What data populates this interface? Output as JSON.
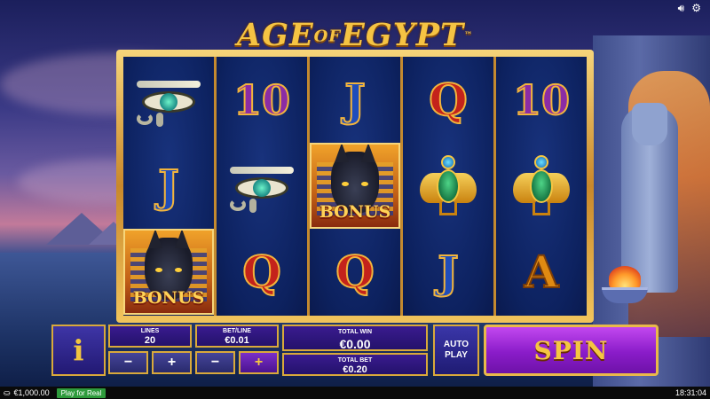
{
  "game": {
    "title_left": "AGE",
    "title_mid": "OF",
    "title_right": "EGYPT",
    "trademark": "™"
  },
  "top_icons": {
    "sound": "speaker-icon",
    "settings": "gear-icon"
  },
  "reels": [
    [
      "eye-of-horus",
      "J",
      "BONUS"
    ],
    [
      "10",
      "eye-of-horus",
      "Q"
    ],
    [
      "J",
      "BONUS",
      "Q"
    ],
    [
      "Q",
      "scarab",
      "J"
    ],
    [
      "10",
      "scarab",
      "A"
    ]
  ],
  "symbol_labels": {
    "ten": "10",
    "queen": "Q",
    "jack": "J",
    "ace": "A",
    "bonus": "BONUS"
  },
  "controls": {
    "info_label": "i",
    "lines_label": "LINES",
    "lines_value": "20",
    "bet_label": "BET/LINE",
    "bet_value": "€0.01",
    "minus": "−",
    "plus": "+",
    "total_win_label": "TOTAL WIN",
    "total_win_value": "€0.00",
    "total_bet_label": "TOTAL BET",
    "total_bet_value": "€0.20",
    "auto_play_line1": "AUTO",
    "auto_play_line2": "PLAY",
    "spin_label": "SPIN"
  },
  "status_bar": {
    "balance": "€1,000.00",
    "play_for_real": "Play for Real",
    "clock": "18:31:04"
  },
  "colors": {
    "accent_gold": "#f4c642",
    "spin_purple": "#a02fdc",
    "real_green": "#2e9b3c"
  }
}
